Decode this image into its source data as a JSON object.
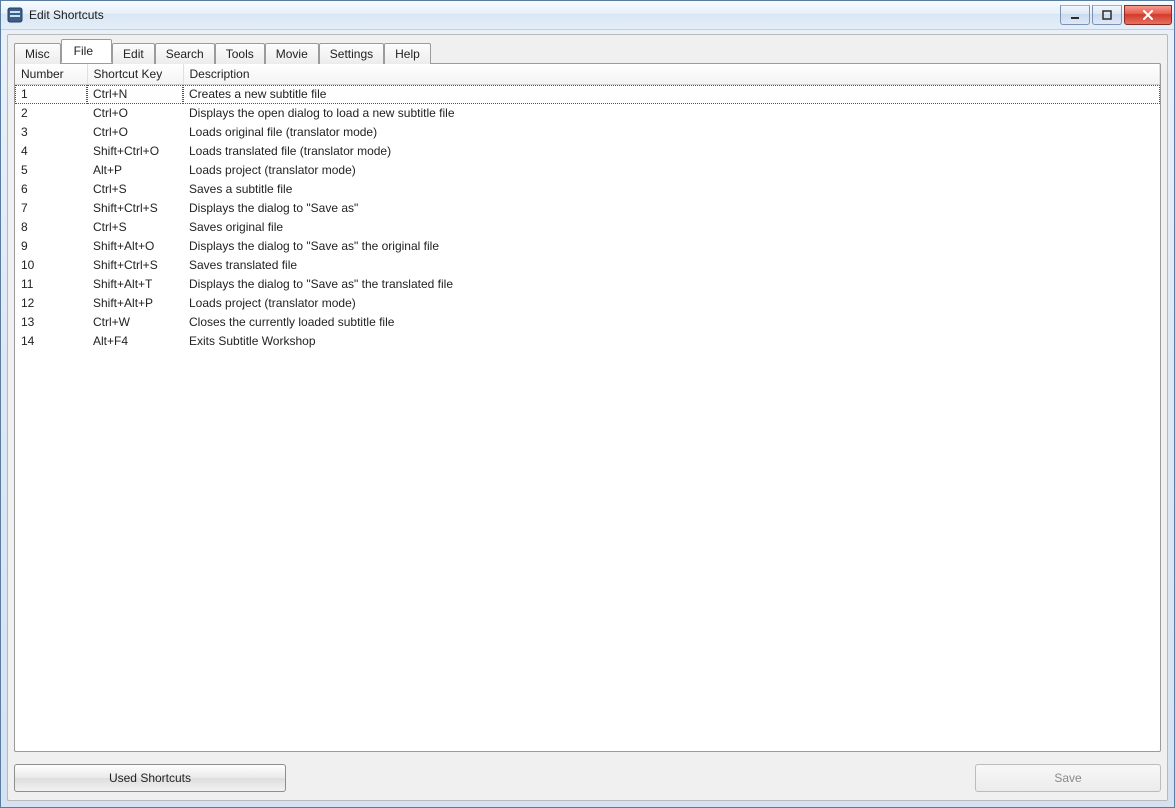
{
  "window": {
    "title": "Edit Shortcuts"
  },
  "tabs": [
    {
      "label": "Misc"
    },
    {
      "label": "File"
    },
    {
      "label": "Edit"
    },
    {
      "label": "Search"
    },
    {
      "label": "Tools"
    },
    {
      "label": "Movie"
    },
    {
      "label": "Settings"
    },
    {
      "label": "Help"
    }
  ],
  "active_tab_index": 1,
  "columns": {
    "number": "Number",
    "shortcut": "Shortcut Key",
    "description": "Description"
  },
  "rows": [
    {
      "num": "1",
      "key": "Ctrl+N",
      "desc": "Creates a new subtitle file"
    },
    {
      "num": "2",
      "key": "Ctrl+O",
      "desc": "Displays the open dialog to load a new subtitle file"
    },
    {
      "num": "3",
      "key": "Ctrl+O",
      "desc": "Loads original file (translator mode)"
    },
    {
      "num": "4",
      "key": "Shift+Ctrl+O",
      "desc": "Loads translated file (translator mode)"
    },
    {
      "num": "5",
      "key": "Alt+P",
      "desc": "Loads project (translator mode)"
    },
    {
      "num": "6",
      "key": "Ctrl+S",
      "desc": "Saves a subtitle file"
    },
    {
      "num": "7",
      "key": "Shift+Ctrl+S",
      "desc": "Displays the dialog to \"Save as\""
    },
    {
      "num": "8",
      "key": "Ctrl+S",
      "desc": "Saves original file"
    },
    {
      "num": "9",
      "key": "Shift+Alt+O",
      "desc": "Displays the dialog to \"Save as\" the original file"
    },
    {
      "num": "10",
      "key": "Shift+Ctrl+S",
      "desc": "Saves translated file"
    },
    {
      "num": "11",
      "key": "Shift+Alt+T",
      "desc": "Displays the dialog to \"Save as\" the translated file"
    },
    {
      "num": "12",
      "key": "Shift+Alt+P",
      "desc": "Loads project (translator mode)"
    },
    {
      "num": "13",
      "key": "Ctrl+W",
      "desc": "Closes the currently loaded subtitle file"
    },
    {
      "num": "14",
      "key": "Alt+F4",
      "desc": "Exits Subtitle Workshop"
    }
  ],
  "selected_row_index": 0,
  "buttons": {
    "used_shortcuts": "Used Shortcuts",
    "save": "Save"
  }
}
